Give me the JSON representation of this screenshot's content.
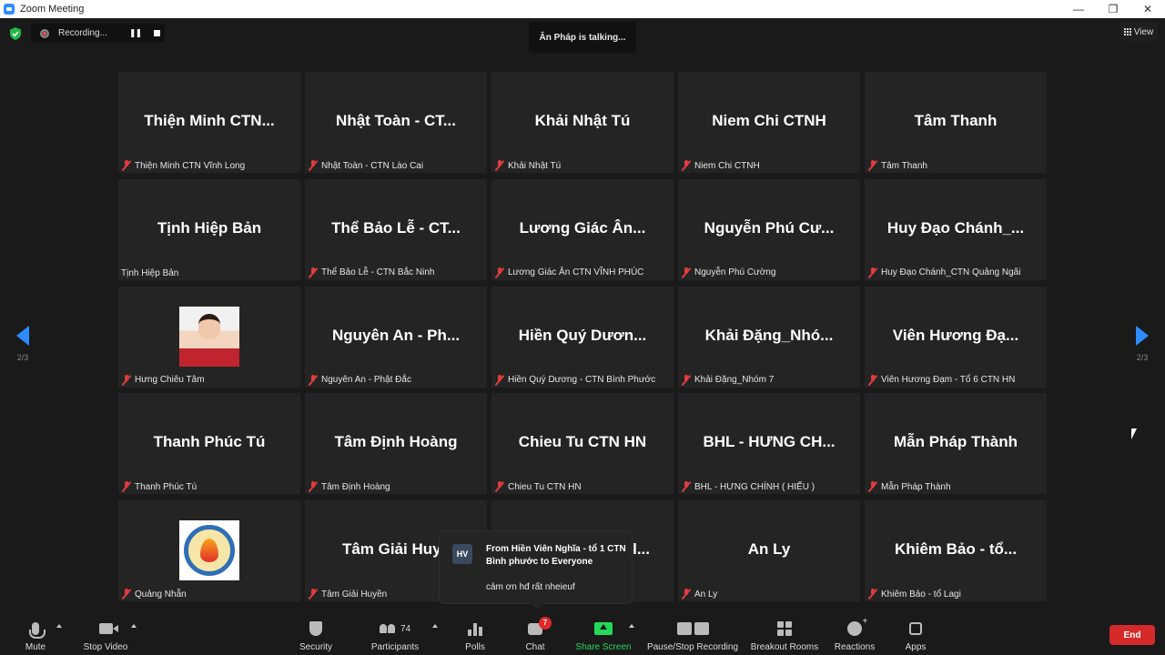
{
  "window": {
    "title": "Zoom Meeting",
    "minimize": "—",
    "maximize": "❐",
    "close": "✕"
  },
  "recording": {
    "label": "Recording..."
  },
  "talking": {
    "text": "Ân Pháp is talking..."
  },
  "view": {
    "label": "View"
  },
  "pagination": {
    "left": "2/3",
    "right": "2/3"
  },
  "tiles": [
    {
      "big": "Thiện Minh CTN...",
      "label": "Thiện Minh CTN Vĩnh Long",
      "muted": true
    },
    {
      "big": "Nhật Toàn - CT...",
      "label": "Nhật Toàn - CTN Lào Cai",
      "muted": true
    },
    {
      "big": "Khải Nhật Tú",
      "label": "Khải Nhật Tú",
      "muted": true
    },
    {
      "big": "Niem Chi CTNH",
      "label": "Niem Chi CTNH",
      "muted": true
    },
    {
      "big": "Tâm Thanh",
      "label": "Tâm Thanh",
      "muted": true
    },
    {
      "big": "Tịnh Hiệp Bản",
      "label": "Tịnh Hiệp Bản",
      "muted": false
    },
    {
      "big": "Thể Bảo Lễ - CT...",
      "label": "Thể Bảo Lễ - CTN Bắc Ninh",
      "muted": true
    },
    {
      "big": "Lương Giác Ân...",
      "label": "Lương Giác Ân CTN VĨNH PHÚC",
      "muted": true
    },
    {
      "big": "Nguyễn Phú Cư...",
      "label": "Nguyễn Phú Cường",
      "muted": true
    },
    {
      "big": "Huy Đạo Chánh_...",
      "label": "Huy Đạo Chánh_CTN Quảng Ngãi",
      "muted": true
    },
    {
      "big": "",
      "label": "Hưng Chiêu Tâm",
      "muted": true,
      "avatar": "photo"
    },
    {
      "big": "Nguyên An - Ph...",
      "label": "Nguyên An - Phật Đắc",
      "muted": true
    },
    {
      "big": "Hiền Quý Dươn...",
      "label": "Hiền Quý Dương - CTN Bình Phước",
      "muted": true
    },
    {
      "big": "Khải Đặng_Nhó...",
      "label": "Khải Đặng_Nhóm 7",
      "muted": true
    },
    {
      "big": "Viên Hương Đạ...",
      "label": "Viên Hương Đạm - Tổ 6 CTN HN",
      "muted": true
    },
    {
      "big": "Thanh Phúc Tú",
      "label": "Thanh Phúc Tú",
      "muted": true
    },
    {
      "big": "Tâm Định Hoàng",
      "label": "Tâm Định Hoàng",
      "muted": true
    },
    {
      "big": "Chieu Tu CTN HN",
      "label": "Chieu Tu CTN HN",
      "muted": true
    },
    {
      "big": "BHL - HƯNG CH...",
      "label": "BHL - HƯNG CHÍNH ( HIẾU )",
      "muted": true
    },
    {
      "big": "Mẫn Pháp Thành",
      "label": "Mẫn Pháp Thành",
      "muted": true
    },
    {
      "big": "",
      "label": "Quảng Nhẫn",
      "muted": true,
      "avatar": "logo"
    },
    {
      "big": "Tâm Giải Huyề",
      "label": "Tâm Giải Huyền",
      "muted": true
    },
    {
      "big": "l...",
      "label": "",
      "muted": false
    },
    {
      "big": "An Ly",
      "label": "An Ly",
      "muted": true
    },
    {
      "big": "Khiêm Bảo - tổ...",
      "label": "Khiêm Bảo - tổ Lagi",
      "muted": true
    }
  ],
  "chat_popup": {
    "initials": "HV",
    "from": "From Hiền Viên Nghĩa - tổ 1 CTN Bình phước to Everyone",
    "message": "cảm ơn hđ rất nheieuf"
  },
  "toolbar": {
    "mute": "Mute",
    "stop_video": "Stop Video",
    "security": "Security",
    "participants": "Participants",
    "participant_count": "74",
    "polls": "Polls",
    "chat": "Chat",
    "chat_badge": "7",
    "share_screen": "Share Screen",
    "recording": "Pause/Stop Recording",
    "breakout": "Breakout Rooms",
    "reactions": "Reactions",
    "apps": "Apps",
    "end": "End"
  },
  "colors": {
    "accent": "#2d8cff",
    "share": "#23d959",
    "end": "#d42a2a",
    "muted": "#e03c3c"
  }
}
